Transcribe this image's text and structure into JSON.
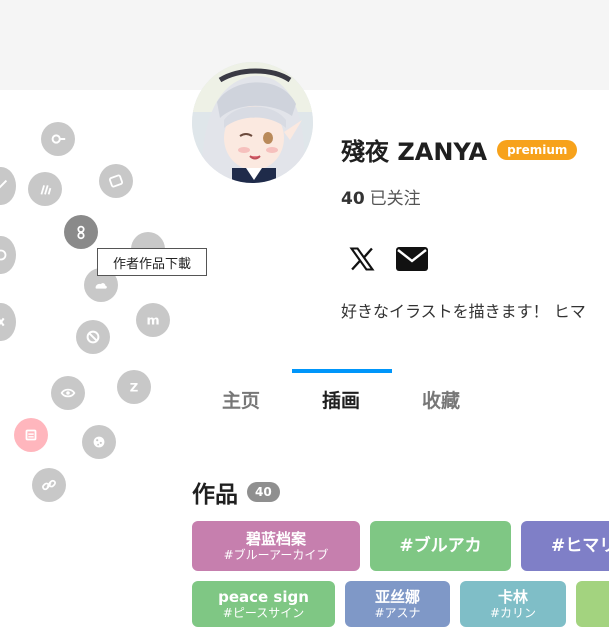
{
  "tooltip": {
    "text": "作者作品下載"
  },
  "profile": {
    "name": "殘夜 ZANYA",
    "badge": "premium",
    "following_count": "40",
    "following_label": "已关注",
    "bio": "好きなイラストを描きます！ ヒマ"
  },
  "social": {
    "x": "x-icon",
    "mail": "mail-icon"
  },
  "tabs": [
    {
      "label": "主页",
      "active": false
    },
    {
      "label": "插画",
      "active": true
    },
    {
      "label": "收藏",
      "active": false
    }
  ],
  "works": {
    "title": "作品",
    "count": "40"
  },
  "tags_row1": [
    {
      "main": "碧蓝档案",
      "sub": "#ブルーアーカイブ",
      "color": "#c67fae"
    },
    {
      "main": "#ブルアカ",
      "sub": "",
      "color": "#7fc784"
    },
    {
      "main": "#ヒマリ",
      "sub": "",
      "color": "#7f7fc7"
    }
  ],
  "tags_row2": [
    {
      "main": "peace sign",
      "sub": "#ピースサイン",
      "color": "#7fc784"
    },
    {
      "main": "亚丝娜",
      "sub": "#アスナ",
      "color": "#7f98c7"
    },
    {
      "main": "卡林",
      "sub": "#カリン",
      "color": "#7fbec7"
    },
    {
      "main": "",
      "sub": "",
      "color": "#a3d37f"
    }
  ],
  "floating_icons": [
    "key-icon",
    "share-icon",
    "slash-lines-icon",
    "download-icon",
    "user-icon",
    "link-arrow-icon",
    "cloud-icon",
    "block-icon",
    "m-icon",
    "hash-icon",
    "eye-icon",
    "z-icon",
    "note-icon",
    "cookie-icon",
    "chain-icon",
    "circle-icon"
  ],
  "colors": {
    "accent": "#0096fa",
    "premium": "#f7a21b",
    "badge": "#8f8f8f"
  }
}
